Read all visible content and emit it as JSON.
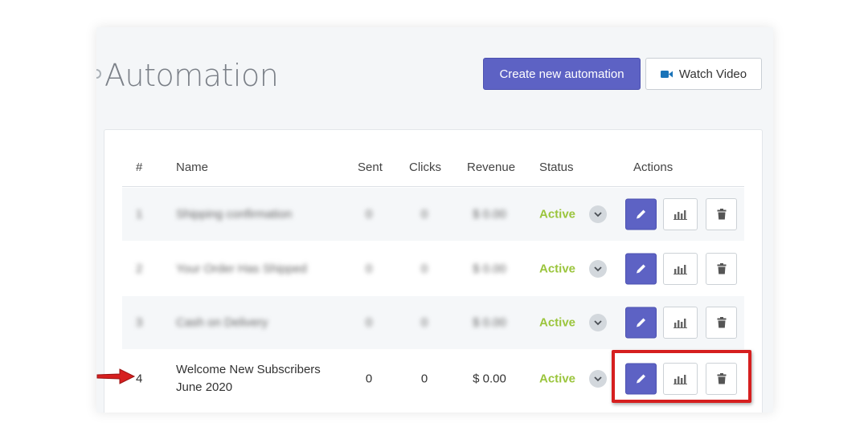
{
  "page": {
    "title": "Automation"
  },
  "toolbar": {
    "create_label": "Create new automation",
    "watch_label": "Watch Video"
  },
  "table": {
    "headers": {
      "num": "#",
      "name": "Name",
      "sent": "Sent",
      "clicks": "Clicks",
      "revenue": "Revenue",
      "status": "Status",
      "actions": "Actions"
    },
    "rows": [
      {
        "num": "1",
        "name": "Shipping confirmation",
        "sent": "0",
        "clicks": "0",
        "revenue": "$ 0.00",
        "status": "Active",
        "blurred": true
      },
      {
        "num": "2",
        "name": "Your Order Has Shipped",
        "sent": "0",
        "clicks": "0",
        "revenue": "$ 0.00",
        "status": "Active",
        "blurred": true
      },
      {
        "num": "3",
        "name": "Cash on Delivery",
        "sent": "0",
        "clicks": "0",
        "revenue": "$ 0.00",
        "status": "Active",
        "blurred": true
      },
      {
        "num": "4",
        "name_line1": "Welcome New Subscribers",
        "name_line2": "June 2020",
        "sent": "0",
        "clicks": "0",
        "revenue": "$ 0.00",
        "status": "Active",
        "blurred": false
      }
    ]
  },
  "colors": {
    "primary": "#5d62c4",
    "active_status": "#9bc53d",
    "highlight": "#d61f1f",
    "video_icon": "#1a73b8"
  },
  "icons": [
    "video-camera-icon",
    "chevron-down-icon",
    "pencil-icon",
    "bar-chart-icon",
    "trash-icon",
    "red-arrow-icon"
  ]
}
